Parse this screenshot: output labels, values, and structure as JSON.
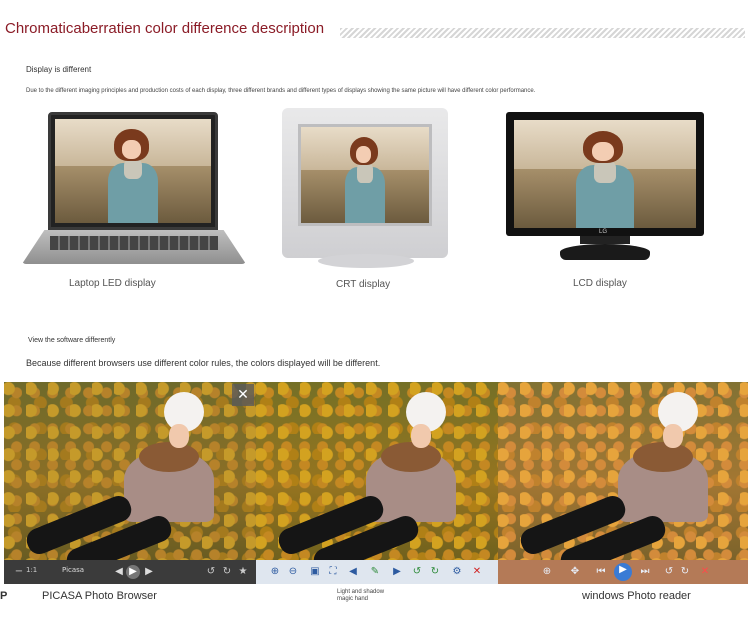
{
  "header": {
    "title": "Chromaticaberratien color difference description"
  },
  "section1": {
    "label": "Display is different",
    "description": "Due to the different imaging principles and production costs of each display, three different brands and different types of displays showing the same picture will have different color performance.",
    "displays": [
      {
        "caption": "Laptop LED display",
        "icon": "laptop-icon"
      },
      {
        "caption": "CRT display",
        "icon": "crt-monitor-icon"
      },
      {
        "caption": "LCD display",
        "icon": "lcd-monitor-icon",
        "brand": "LG"
      }
    ]
  },
  "section2": {
    "label": "View the software differently",
    "description": "Because different browsers use different color rules, the colors displayed will be different.",
    "viewers": [
      {
        "caption": "PICASA Photo Browser",
        "prefix": "P",
        "toolbar_text": "Picasa",
        "toolbar_counter": "1:1"
      },
      {
        "caption": "Light and shadow magic hand"
      },
      {
        "caption": "windows Photo reader"
      }
    ],
    "close_label": "✕"
  },
  "colors": {
    "title": "#8b1c27",
    "picasa_toolbar": "#3b3b3b",
    "magic_toolbar": "#dfe6ef",
    "windows_toolbar": "#b47a57"
  }
}
